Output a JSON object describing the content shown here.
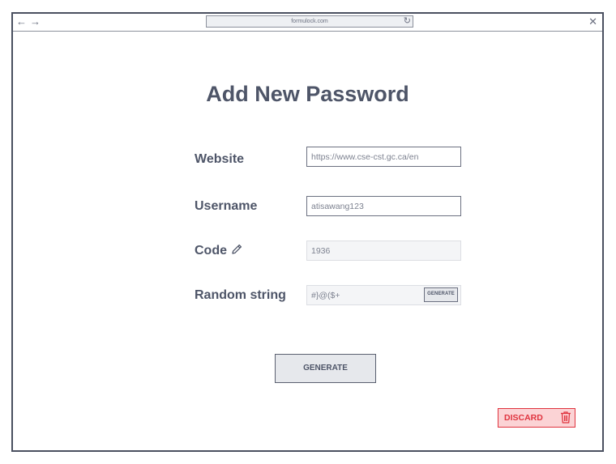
{
  "browser": {
    "url": "formulock.com",
    "back_icon": "arrow-left-icon",
    "forward_icon": "arrow-right-icon",
    "reload_icon": "reload-icon",
    "close_icon": "close-icon"
  },
  "page": {
    "title": "Add New Password"
  },
  "form": {
    "website": {
      "label": "Website",
      "value": "https://www.cse-cst.gc.ca/en"
    },
    "username": {
      "label": "Username",
      "value": "atisawang123"
    },
    "code": {
      "label": "Code",
      "value": "1936",
      "icon": "pencil-icon"
    },
    "random_string": {
      "label": "Random string",
      "value": "#}@($+",
      "button_label": "GENERATE"
    }
  },
  "actions": {
    "generate_label": "GENERATE",
    "discard_label": "DISCARD",
    "discard_icon": "trash-icon"
  },
  "colors": {
    "text": "#4e5568",
    "danger": "#e0343f",
    "danger_bg": "#fbd3d5"
  }
}
